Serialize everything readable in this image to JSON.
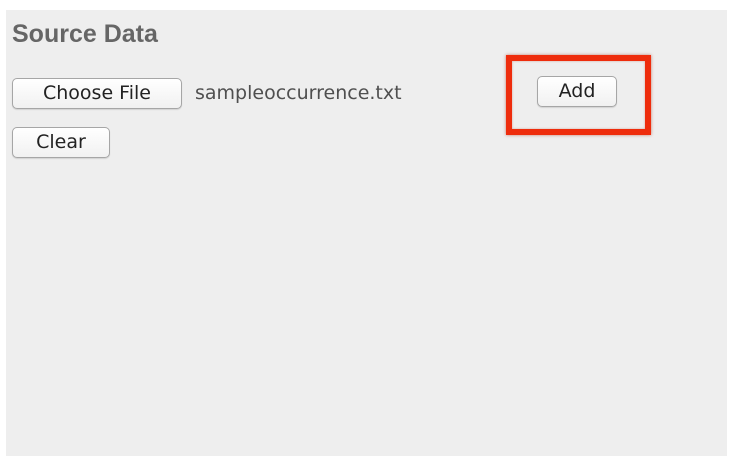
{
  "source_data": {
    "title": "Source Data",
    "choose_file_label": "Choose File",
    "selected_file_name": "sampleoccurrence.txt",
    "add_label": "Add",
    "clear_label": "Clear"
  },
  "annotation": {
    "highlight_target": "add-button",
    "highlight_color": "#ee2c0c"
  },
  "colors": {
    "panel_background": "#eeeeee",
    "title_text": "#666666"
  }
}
